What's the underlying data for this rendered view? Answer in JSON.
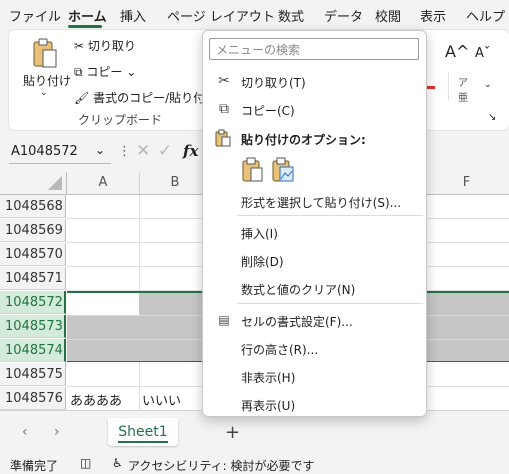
{
  "menubar": {
    "tabs": [
      "ファイル",
      "ホーム",
      "挿入",
      "ページ レイアウト",
      "数式",
      "データ",
      "校閲",
      "表示",
      "ヘルプ"
    ]
  },
  "ribbon": {
    "paste": "貼り付け",
    "cut": "切り取り",
    "copy": "コピー",
    "format_painter": "書式のコピー/貼り付け",
    "group_clipboard": "クリップボード"
  },
  "formula": {
    "namebox": "A1048572"
  },
  "grid": {
    "columns": [
      "A",
      "B",
      "F"
    ],
    "rows": [
      {
        "num": "1048568",
        "a": "",
        "b": ""
      },
      {
        "num": "1048569",
        "a": "",
        "b": ""
      },
      {
        "num": "1048570",
        "a": "",
        "b": ""
      },
      {
        "num": "1048571",
        "a": "",
        "b": ""
      },
      {
        "num": "1048572",
        "a": "",
        "b": ""
      },
      {
        "num": "1048573",
        "a": "",
        "b": ""
      },
      {
        "num": "1048574",
        "a": "",
        "b": ""
      },
      {
        "num": "1048575",
        "a": "",
        "b": ""
      },
      {
        "num": "1048576",
        "a": "ああああ",
        "b": "いいい"
      }
    ]
  },
  "sheets": {
    "active": "Sheet1",
    "add": "+"
  },
  "status": {
    "ready": "準備完了",
    "accessibility": "アクセシビリティ: 検討が必要です"
  },
  "context_menu": {
    "search_placeholder": "メニューの検索",
    "cut": "切り取り(T)",
    "copy": "コピー(C)",
    "paste_options": "貼り付けのオプション:",
    "paste_special": "形式を選択して貼り付け(S)...",
    "insert": "挿入(I)",
    "delete": "削除(D)",
    "clear_contents": "数式と値のクリア(N)",
    "format_cells": "セルの書式設定(F)...",
    "row_height": "行の高さ(R)...",
    "hide": "非表示(H)",
    "unhide": "再表示(U)"
  },
  "colors": {
    "accent": "#217346",
    "selected_row": "#d3ebd9",
    "selection_fill": "#c6c6c6"
  }
}
